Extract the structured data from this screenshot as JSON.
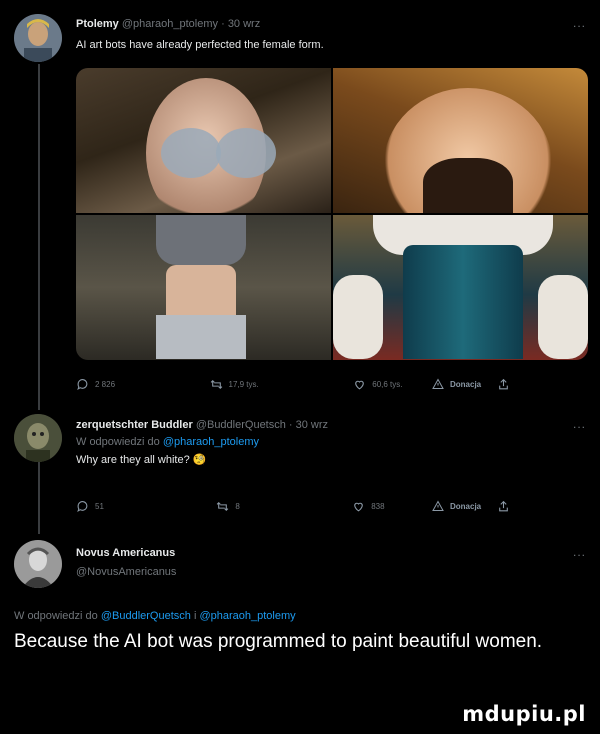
{
  "tweets": [
    {
      "name": "Ptolemy",
      "handle": "@pharaoh_ptolemy",
      "time": "· 30 wrz",
      "text": "AI art bots have already perfected the female form.",
      "stats": {
        "replies": "2 826",
        "retweets": "17,9 tys.",
        "likes": "60,6 tys."
      },
      "donate": "Donacja"
    },
    {
      "name": "zerquetschter Buddler",
      "handle": "@BuddlerQuetsch",
      "time": "· 30 wrz",
      "reply_prefix": "W odpowiedzi do",
      "reply_mention": "@pharaoh_ptolemy",
      "text": "Why are they all white? 🧐",
      "stats": {
        "replies": "51",
        "retweets": "8",
        "likes": "838"
      },
      "donate": "Donacja"
    },
    {
      "name": "Novus Americanus",
      "handle": "@NovusAmericanus",
      "reply_prefix": "W odpowiedzi do",
      "reply_mention_1": "@BuddlerQuetsch",
      "reply_joiner": "i",
      "reply_mention_2": "@pharaoh_ptolemy",
      "text": "Because the AI bot was programmed to paint beautiful women."
    }
  ],
  "more_icon": "...",
  "watermark": "mdupiu.pl",
  "colors": {
    "background": "#000000",
    "muted": "#71767b",
    "mention": "#1d9bf0"
  }
}
